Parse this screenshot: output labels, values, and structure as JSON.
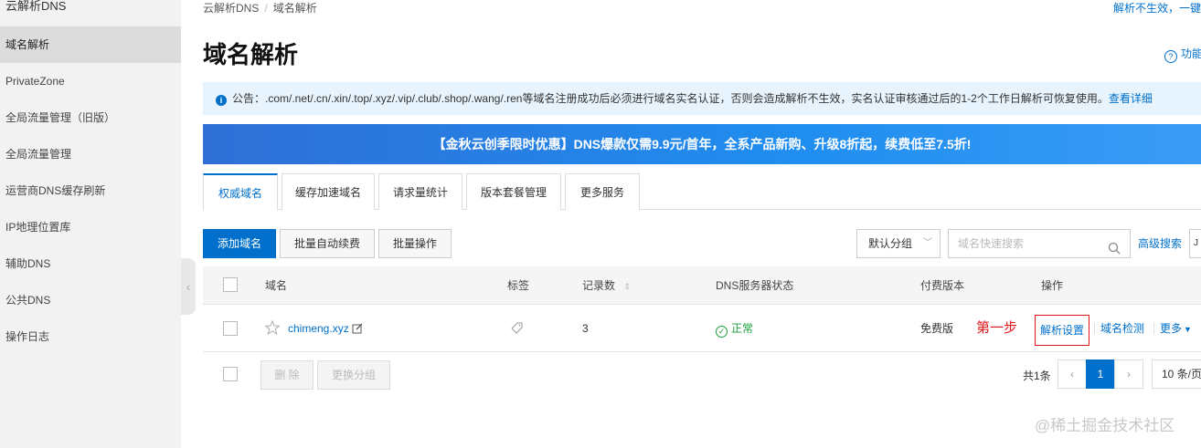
{
  "sidebar": {
    "title": "云解析DNS",
    "items": [
      {
        "label": "域名解析"
      },
      {
        "label": "PrivateZone"
      },
      {
        "label": "全局流量管理（旧版）"
      },
      {
        "label": "全局流量管理"
      },
      {
        "label": "运营商DNS缓存刷新"
      },
      {
        "label": "IP地理位置库"
      },
      {
        "label": "辅助DNS"
      },
      {
        "label": "公共DNS"
      },
      {
        "label": "操作日志"
      }
    ]
  },
  "breadcrumb": {
    "root": "云解析DNS",
    "sep": "/",
    "current": "域名解析"
  },
  "top_right_link": "解析不生效，一键",
  "page_title": "域名解析",
  "help_link": "功能",
  "notice": {
    "text": "公告：.com/.net/.cn/.xin/.top/.xyz/.vip/.club/.shop/.wang/.ren等域名注册成功后必须进行域名实名认证，否则会造成解析不生效，实名认证审核通过后的1-2个工作日解析可恢复使用。",
    "link": "查看详细"
  },
  "banner": "【金秋云创季限时优惠】DNS爆款仅需9.9元/首年，全系产品新购、升级8折起，续费低至7.5折!",
  "tabs": [
    {
      "label": "权威域名"
    },
    {
      "label": "缓存加速域名"
    },
    {
      "label": "请求量统计"
    },
    {
      "label": "版本套餐管理"
    },
    {
      "label": "更多服务"
    }
  ],
  "toolbar": {
    "add_domain": "添加域名",
    "batch_renew": "批量自动续费",
    "batch_ops": "批量操作",
    "group_select": "默认分组",
    "search_placeholder": "域名快速搜索",
    "advanced_search": "高级搜索",
    "edge_button": "J"
  },
  "table": {
    "headers": {
      "domain": "域名",
      "tag": "标签",
      "records": "记录数",
      "dns_status": "DNS服务器状态",
      "edition": "付费版本",
      "actions": "操作"
    },
    "rows": [
      {
        "domain": "chimeng.xyz",
        "records": "3",
        "status": "正常",
        "edition": "免费版",
        "annotation": "第一步",
        "action_resolve": "解析设置",
        "action_check": "域名检测",
        "action_more": "更多"
      }
    ]
  },
  "footer": {
    "delete": "删 除",
    "change_group": "更换分组",
    "total": "共1条",
    "current_page": "1",
    "page_size": "10 条/页"
  },
  "watermark": "@稀土掘金技术社区",
  "colors": {
    "accent": "#0070cc",
    "ok": "#1a9e3f",
    "highlight": "#e0161b"
  }
}
